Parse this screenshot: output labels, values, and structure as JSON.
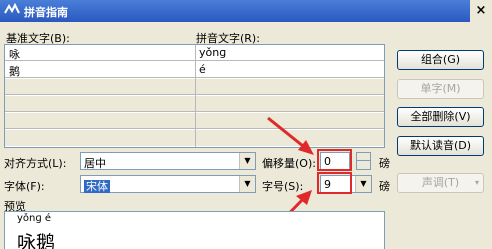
{
  "window": {
    "title": "拼音指南",
    "close": "×"
  },
  "table": {
    "headers": [
      "基准文字(B):",
      "拼音文字(R):"
    ],
    "rows": [
      {
        "base": "咏",
        "ruby": "yǒnɡ"
      },
      {
        "base": "鹅",
        "ruby": "é"
      }
    ]
  },
  "buttons": {
    "combine": "组合(G)",
    "single": "单字(M)",
    "clear_all": "全部删除(V)",
    "default_reading": "默认读音(D)",
    "tone": "声调(T)"
  },
  "alignment": {
    "label": "对齐方式(L):",
    "value": "居中"
  },
  "offset": {
    "label": "偏移量(O):",
    "value": "0",
    "unit": "磅"
  },
  "font": {
    "label": "字体(F):",
    "value": "宋体"
  },
  "font_size": {
    "label": "字号(S):",
    "value": "9",
    "unit": "磅"
  },
  "preview": {
    "label": "预览",
    "ruby": "yǒnɡ é",
    "text": "咏鹅"
  },
  "colors": {
    "title_bar": "#2a58c0",
    "highlight": "#e0292a",
    "selection": "#316ac5"
  }
}
